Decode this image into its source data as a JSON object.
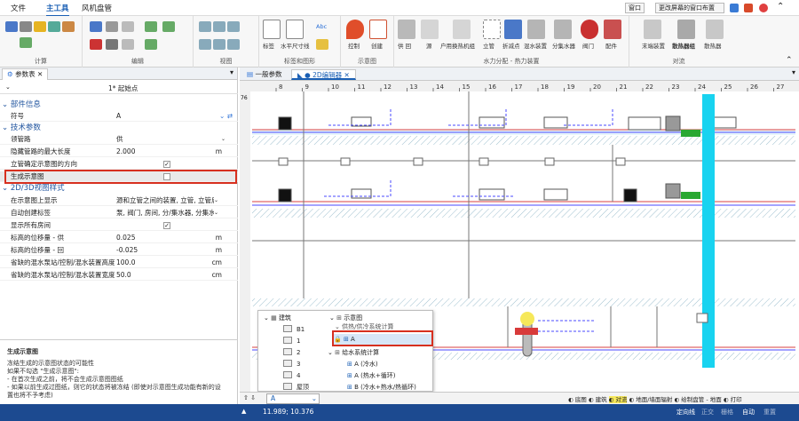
{
  "menu": {
    "file": "文件",
    "main_tools": "主工具",
    "duct_design": "风机盘管",
    "window_btn": "窗口",
    "window_layout": "更改屏幕的窗口布置"
  },
  "ribbon": {
    "groups": [
      "计算",
      "编辑",
      "视图",
      "标签和图形",
      "示意图",
      "水力分配 - 热力装置",
      "对流"
    ],
    "buttons": {
      "tag": "标签",
      "horizontal_size": "水平尺寸线",
      "abc": "Abc",
      "control": "控制",
      "create": "创建",
      "supply_return": "供 回",
      "source": "源",
      "user_heat_exchanger": "户用换热机组",
      "riser": "立管",
      "break_point": "折减点",
      "mix_device": "混水装置",
      "distributor": "分集水器",
      "valve": "阀门",
      "fitting": "配件",
      "terminal": "末端装置",
      "radiator_group": "散热器组",
      "radiator": "散热器"
    }
  },
  "left_panel": {
    "tab_label": "参数表",
    "header_value": "1* 起始点",
    "sections": {
      "component_info": "部件信息",
      "tech_params": "技术参数",
      "view_style": "2D/3D视图样式"
    },
    "rows": [
      {
        "name": "符号",
        "value": "A",
        "unit": ""
      },
      {
        "name": "领管路",
        "value": "供",
        "unit": ""
      },
      {
        "name": "隐藏管路的最大长度",
        "value": "2.000",
        "unit": "m"
      },
      {
        "name": "立管确定示意图的方向",
        "value": "",
        "unit": ""
      },
      {
        "name": "生成示意图",
        "value": "",
        "unit": ""
      },
      {
        "name": "在示意图上显示",
        "value": "源和立管之间的装置, 立管, 立管后",
        "unit": ""
      },
      {
        "name": "自动创建标签",
        "value": "泵, 阀门, 房间, 分/集水器, 分集水器",
        "unit": ""
      },
      {
        "name": "显示所有房间",
        "value": "",
        "unit": ""
      },
      {
        "name": "标高的位移量 - 供",
        "value": "0.025",
        "unit": "m"
      },
      {
        "name": "标高的位移量 - 回",
        "value": "-0.025",
        "unit": "m"
      },
      {
        "name": "省缺的混水泵站/控制/混水装置高度",
        "value": "100.0",
        "unit": "cm"
      },
      {
        "name": "省缺的混水泵站/控制/混水装置宽度",
        "value": "50.0",
        "unit": "cm"
      }
    ],
    "description_title": "生成示意图",
    "description_lines": [
      "冻结生成的示意图状态的可能性",
      "如果不勾选 \"生成示意图\":",
      "- 在首次生成之前，将不会生成示意图图纸",
      "- 如果以前生成过图纸，则它的状态将被冻结 (即使对示意图生成功能有新的设",
      "置也将不予考虑)"
    ]
  },
  "draw_area": {
    "tab_overview": "一般参数",
    "tab_editor": "2D编辑器",
    "ruler_numbers": [
      "8",
      "9",
      "10",
      "11",
      "12",
      "13",
      "14",
      "15",
      "16",
      "17",
      "18",
      "19",
      "20",
      "21",
      "22",
      "23",
      "24",
      "25",
      "26",
      "27"
    ],
    "ruler_left": "76"
  },
  "tree_popup": {
    "left_tree": {
      "root": "建筑",
      "floors": [
        "B1",
        "1",
        "2",
        "3",
        "4",
        "屋顶"
      ]
    },
    "right_tree": {
      "root": "示意图",
      "group1": "供热/供冷系统计算",
      "selected": "A",
      "group2": "给水系统计算",
      "items": [
        "A (冷水)",
        "A (热水+循环)",
        "B (冷水+热水/热循环)"
      ]
    },
    "dropdown_value": "A"
  },
  "layer_bar": {
    "items": [
      "底图",
      "建筑",
      "对流",
      "地面/墙面辐射",
      "给制盘管 - 地面",
      "打印"
    ]
  },
  "status": {
    "coords": "11.989; 10.376",
    "right_items": [
      "定向线",
      "正交",
      "栅格",
      "自动",
      "重置"
    ]
  },
  "colors": {
    "accent": "#1a5fb4",
    "highlight": "#d7301f",
    "status_bar": "#1c4a90",
    "cyan_riser": "#18d3f0"
  }
}
